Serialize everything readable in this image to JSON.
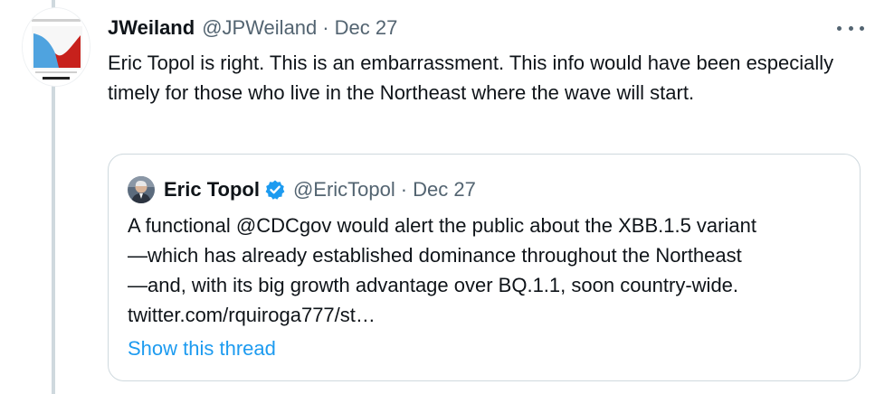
{
  "tweet": {
    "display_name": "JWeiland",
    "handle": "@JPWeiland",
    "separator": "·",
    "date": "Dec 27",
    "text": "Eric Topol is right.  This is an embarrassment.  This info would have been especially timely for those who live in the Northeast where the wave will start."
  },
  "quoted_tweet": {
    "display_name": "Eric Topol",
    "verified": true,
    "handle": "@EricTopol",
    "separator": "·",
    "date": "Dec 27",
    "lines": [
      "A functional @CDCgov would alert the public about the XBB.1.5 variant",
      "—which has already established dominance throughout the Northeast",
      "—and, with its big growth advantage over BQ.1.1, soon country-wide.",
      "twitter.com/rquiroga777/st…"
    ],
    "show_thread": "Show this thread"
  },
  "colors": {
    "text": "#0f1419",
    "secondary": "#536471",
    "link": "#1d9bf0",
    "border": "#cfd9de"
  },
  "icons": {
    "more": "more-dots-icon",
    "verified": "verified-badge-icon"
  }
}
